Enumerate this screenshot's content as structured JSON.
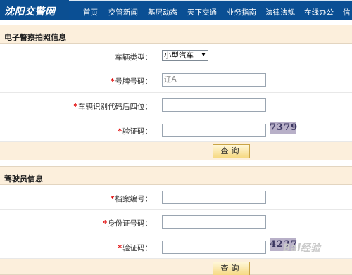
{
  "site": {
    "logo_text": "沈阳交警网"
  },
  "nav": {
    "items": [
      "首页",
      "交管新闻",
      "基层动态",
      "天下交通",
      "业务指南",
      "法律法规",
      "在线办公",
      "信"
    ]
  },
  "section1": {
    "title": "电子警察拍照信息",
    "vehicle_type_label": "车辆类型：",
    "vehicle_type_value": "小型汽车",
    "plate_label": "号牌号码：",
    "plate_value": "辽A",
    "vin_label": "车辆识别代码后四位：",
    "vin_value": "",
    "captcha_label": "验证码：",
    "captcha_value": "",
    "captcha_image_text": "7379",
    "query_button": "查询"
  },
  "section2": {
    "title": "驾驶员信息",
    "file_no_label": "档案编号：",
    "file_no_value": "",
    "id_label": "身份证号码：",
    "id_value": "",
    "captcha_label": "验证码：",
    "captcha_value": "",
    "captcha_image_text": "4237",
    "query_button": "查询"
  },
  "required_mark": "*",
  "watermark_text": "Bai经验"
}
